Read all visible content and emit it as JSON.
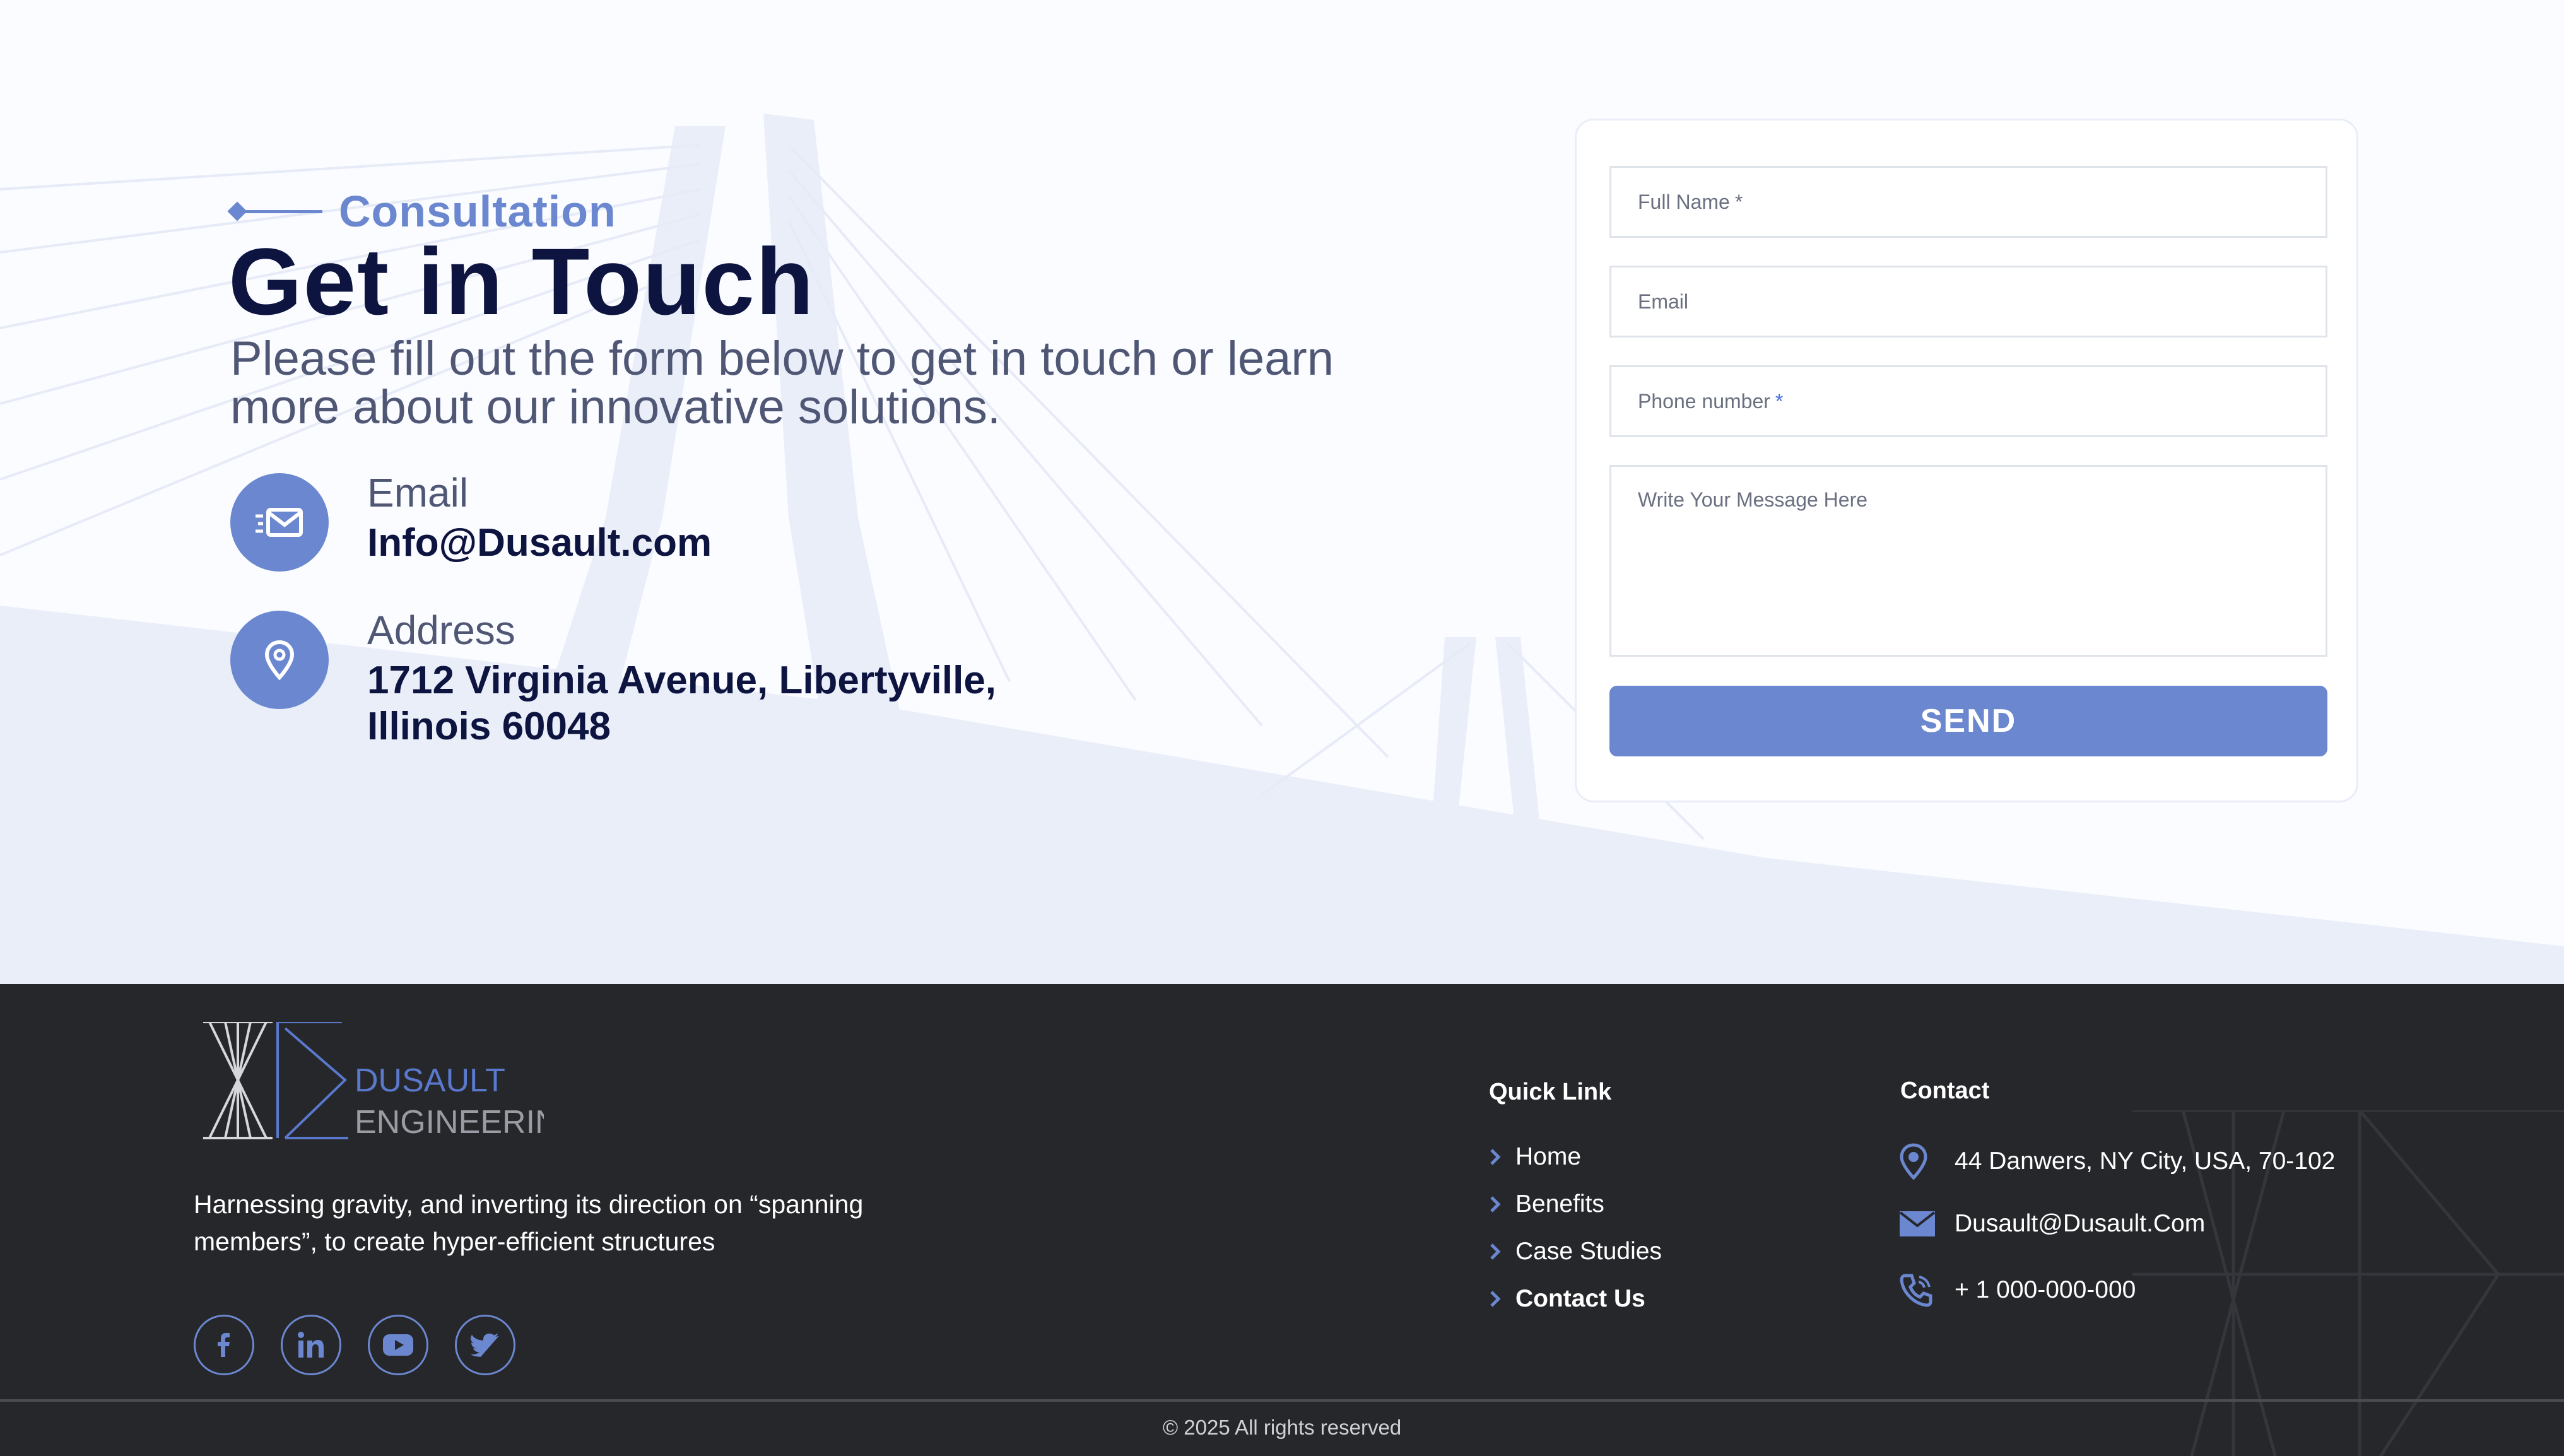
{
  "colors": {
    "accent": "#6b87cf",
    "heading": "#0d1440",
    "body_text": "#4f5775",
    "footer_bg": "#26272b"
  },
  "contact": {
    "eyebrow": "Consultation",
    "title": "Get in Touch",
    "intro": "Please fill out the form below to get in touch or learn more about our innovative solutions.",
    "email": {
      "icon": "envelope-icon",
      "label": "Email",
      "value": "Info@Dusault.com"
    },
    "address": {
      "icon": "location-pin-icon",
      "label": "Address",
      "line1": "1712 Virginia Avenue, Libertyville,",
      "line2": "Illinois 60048"
    }
  },
  "form": {
    "full_name_placeholder": "Full Name",
    "full_name_required": "*",
    "email_placeholder": "Email",
    "phone_placeholder": "Phone number",
    "phone_required": "*",
    "message_placeholder": "Write Your Message Here",
    "submit_label": "SEND"
  },
  "footer": {
    "logo": {
      "line1": "DUSAULT",
      "line2": "ENGINEERING"
    },
    "tagline": "Harnessing gravity, and inverting its direction on “spanning members”, to create hyper-efficient structures",
    "socials": [
      "facebook-icon",
      "linkedin-icon",
      "youtube-icon",
      "twitter-icon"
    ],
    "quick_link": {
      "title": "Quick Link",
      "items": [
        "Home",
        "Benefits",
        "Case Studies",
        "Contact Us"
      ]
    },
    "contact": {
      "title": "Contact",
      "address": "44 Danwers,  NY City, USA, 70-102",
      "email": "Dusault@Dusault.Com",
      "phone": "+ 1 000-000-000"
    },
    "copyright": "© 2025 All rights reserved"
  }
}
